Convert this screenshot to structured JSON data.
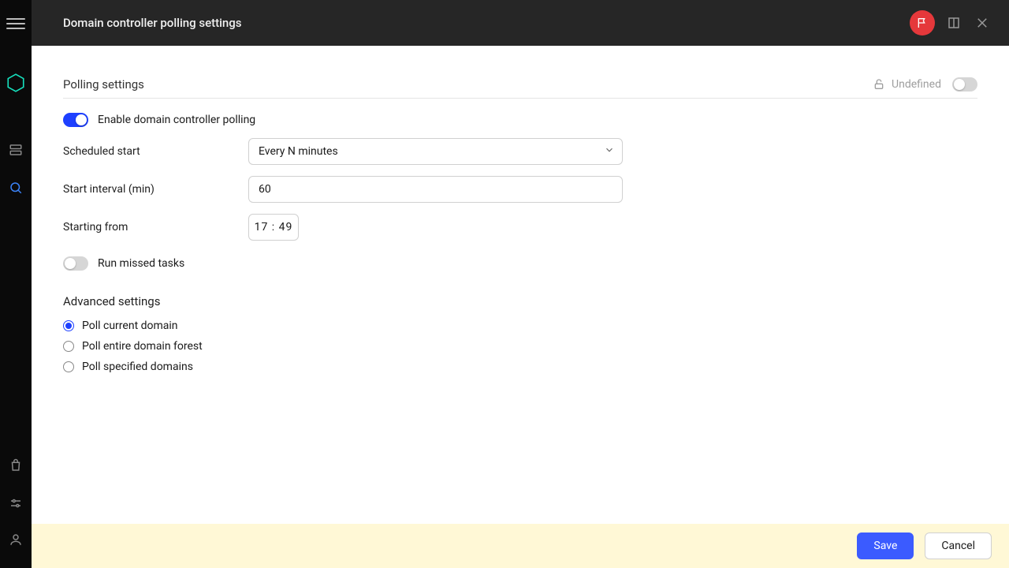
{
  "header": {
    "title": "Domain controller polling settings"
  },
  "section": {
    "title": "Polling settings",
    "lock_state": "Undefined",
    "enable_label": "Enable domain controller polling",
    "enable_on": true,
    "fields": {
      "scheduled_start": {
        "label": "Scheduled start",
        "value": "Every N minutes"
      },
      "start_interval": {
        "label": "Start interval (min)",
        "value": "60"
      },
      "starting_from": {
        "label": "Starting from",
        "value": "17 : 49"
      }
    },
    "run_missed_label": "Run missed tasks",
    "run_missed_on": false
  },
  "advanced": {
    "title": "Advanced settings",
    "options": [
      {
        "label": "Poll current domain",
        "checked": true
      },
      {
        "label": "Poll entire domain forest",
        "checked": false
      },
      {
        "label": "Poll specified domains",
        "checked": false
      }
    ]
  },
  "footer": {
    "save": "Save",
    "cancel": "Cancel"
  }
}
